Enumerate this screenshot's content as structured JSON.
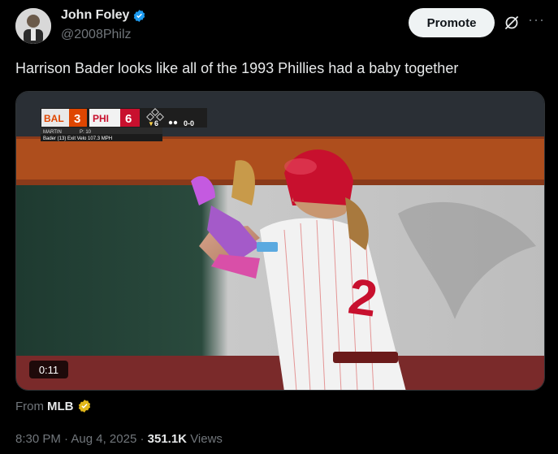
{
  "author": {
    "display_name": "John Foley",
    "handle": "@2008Philz",
    "verified": true,
    "avatar_icon": "profile-photo"
  },
  "header": {
    "promote_label": "Promote",
    "grok_icon": "grok-icon",
    "more_icon": "more-icon"
  },
  "tweet": {
    "text": "Harrison Bader looks like all of the 1993 Phillies had a baby together"
  },
  "media": {
    "duration": "0:11",
    "scorebug": {
      "away_team": "BAL",
      "away_score": "3",
      "home_team": "PHI",
      "home_score": "6",
      "inning": "6",
      "count": "0-0",
      "pitcher": "MARTIN",
      "pitch_count": "P: 10",
      "detail": "Bader (13) Exit Velo 107.3 MPH"
    },
    "jersey_number": "2"
  },
  "source": {
    "prefix": "From",
    "name": "MLB",
    "badge_icon": "gold-verified-icon"
  },
  "meta": {
    "time": "8:30 PM",
    "sep1": "·",
    "date": "Aug 4, 2025",
    "sep2": "·",
    "views": "351.1K",
    "views_label": "Views"
  },
  "colors": {
    "verified_blue": "#1d9bf0",
    "gold_badge": "#e2b719",
    "phillies_red": "#c8102e"
  }
}
